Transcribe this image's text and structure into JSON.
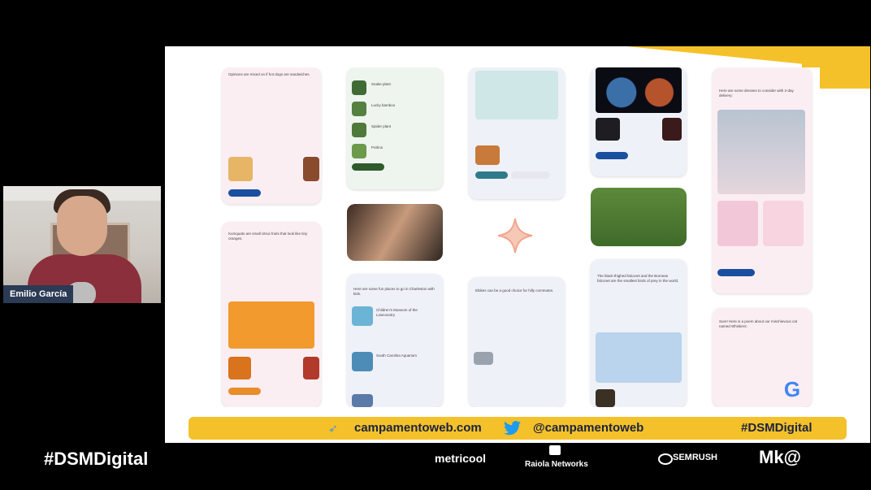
{
  "presenter": {
    "name": "Emilio García"
  },
  "slide": {
    "cards": [
      {
        "text": "Opinions are mixed on if hot dogs are sandwiches."
      },
      {
        "text": "Snake plant"
      },
      {
        "text": "Lucky bamboo"
      },
      {
        "text": "Spider plant"
      },
      {
        "text": "Pothos"
      },
      {
        "text": "Kumquats are small citrus fruits that look like tiny oranges."
      },
      {
        "text": "Here are some fun places to go in Charleston with kids."
      },
      {
        "text": "Children's Museum of the Lowcountry"
      },
      {
        "text": "South Carolina Aquarium"
      },
      {
        "text": "Ebikes can be a good choice for hilly commutes."
      },
      {
        "text": "The black-thighed falconet and the Bornean falconet are the smallest birds of prey in the world."
      },
      {
        "text": "Here are some dresses to consider with 2-day delivery:"
      },
      {
        "text": "Sure! Here is a poem about our mischievous cat named Whiskers:"
      }
    ]
  },
  "footer": {
    "website": "campamentoweb.com",
    "twitter": "@campamentoweb",
    "hashtag": "#DSMDigital"
  },
  "lower_third": {
    "hashtag": "#DSMDigital",
    "sponsors": [
      "metricool",
      "Raiola Networks",
      "SEMRUSH",
      "Mk@"
    ]
  },
  "colors": {
    "accent": "#f4c12a",
    "navy": "#1a2340",
    "twitter": "#1d9bf0"
  }
}
